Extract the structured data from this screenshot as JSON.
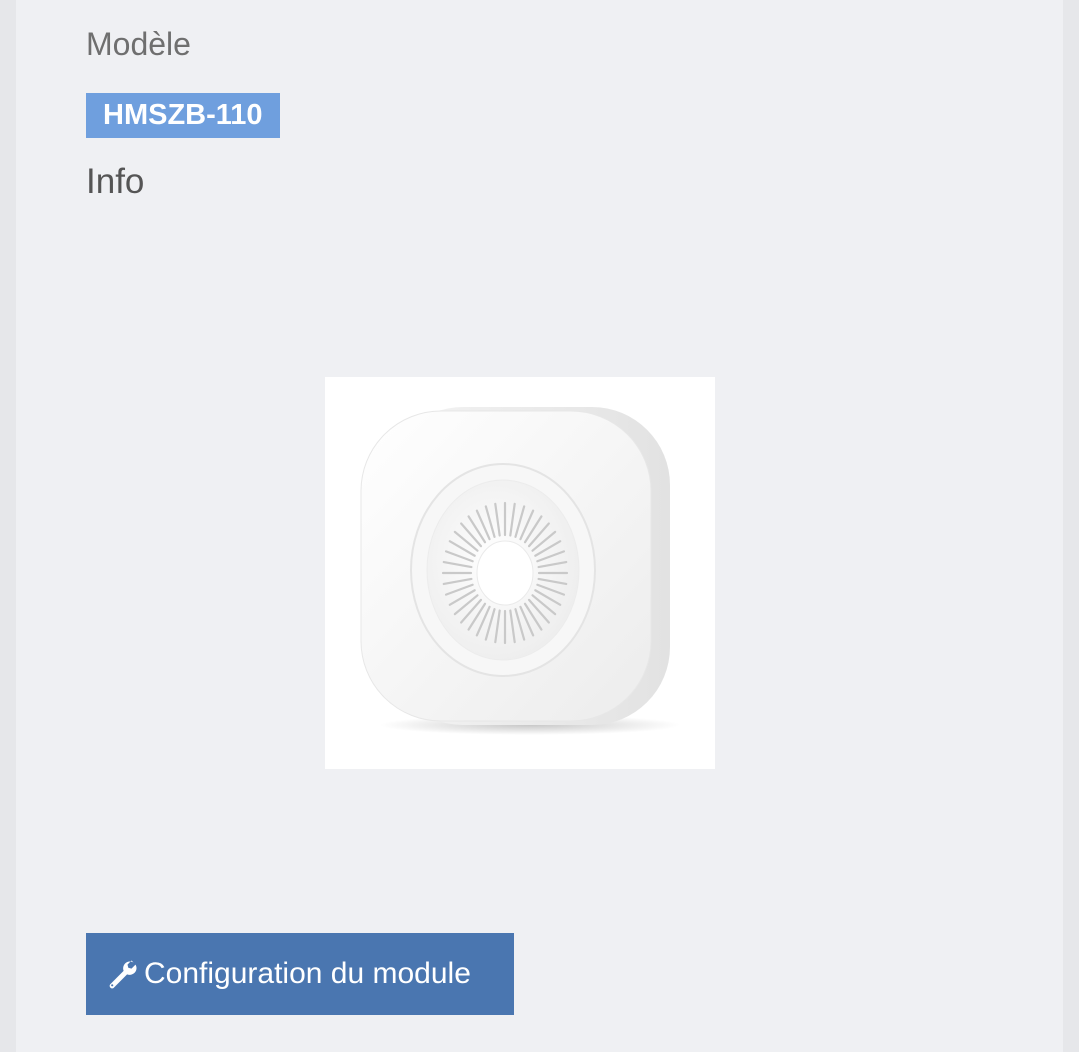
{
  "device": {
    "model_label": "Modèle",
    "model_value": "HMSZB-110",
    "info_label": "Info",
    "image_name": "siren-device-image"
  },
  "actions": {
    "config_label": "Configuration du module",
    "config_icon": "wrench-icon"
  },
  "colors": {
    "badge": "#6f9fde",
    "button": "#4a76b0",
    "panel": "#eff0f3",
    "background": "#e6e7ea"
  }
}
